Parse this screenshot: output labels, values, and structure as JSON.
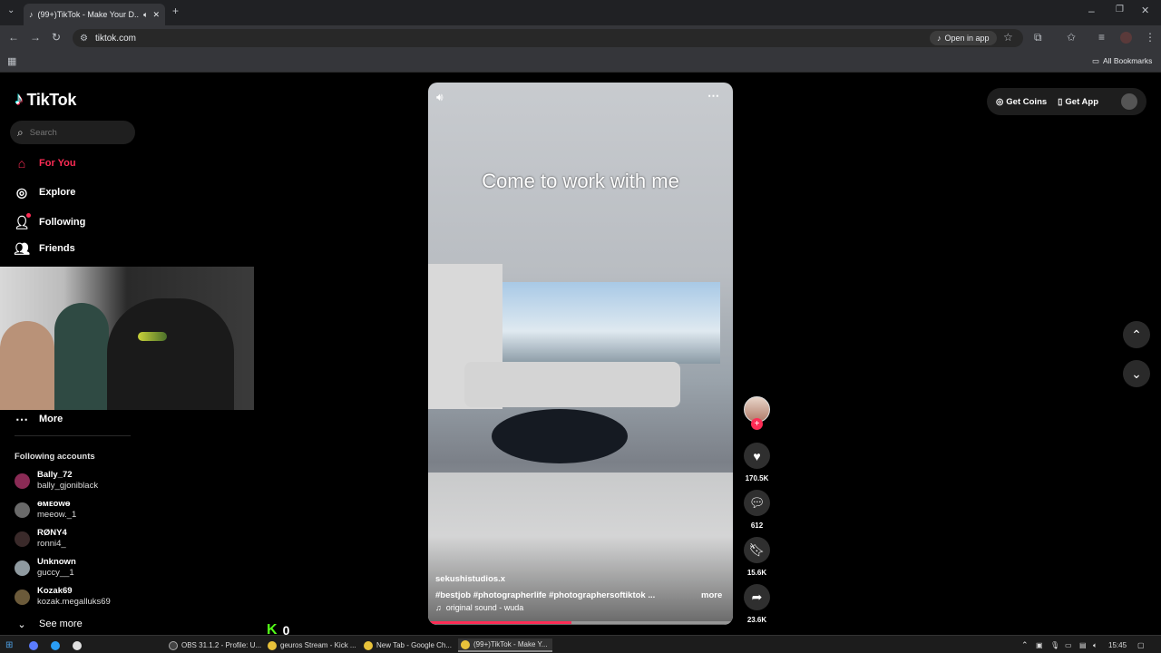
{
  "browser": {
    "tab_title": "(99+)TikTok - Make Your D...",
    "url": "tiktok.com",
    "open_in_app": "Open in app",
    "all_bookmarks": "All Bookmarks"
  },
  "brand": {
    "name": "TikTok"
  },
  "search": {
    "placeholder": "Search"
  },
  "nav": {
    "for_you": "For You",
    "explore": "Explore",
    "following": "Following",
    "friends": "Friends",
    "more": "More"
  },
  "following_accounts": {
    "heading": "Following accounts",
    "see_more": "See more",
    "items": [
      {
        "name": "Bally_72",
        "handle": "bally_gjoniblack"
      },
      {
        "name": "ɵᴍᴇᴏᴡɵ",
        "handle": "meeow._1"
      },
      {
        "name": "RØNY4",
        "handle": "ronni4_"
      },
      {
        "name": "Unknown",
        "handle": "guccy__1"
      },
      {
        "name": "Kozak69",
        "handle": "kozak.megalluks69"
      }
    ]
  },
  "header_actions": {
    "get_coins": "Get Coins",
    "get_app": "Get App"
  },
  "video": {
    "caption_overlay": "Come to work with me",
    "author": "sekushistudios.x",
    "hashtags": "#bestjob  #photographerlife  #photographersoftiktok  ...",
    "more": "more",
    "sound": "original sound - wuda",
    "progress": 0.47
  },
  "actions": {
    "likes": "170.5K",
    "comments": "612",
    "saves": "15.6K",
    "shares": "23.6K"
  },
  "stream_overlay": {
    "counter": "0"
  },
  "taskbar": {
    "obs": "OBS 31.1.2 - Profile: U...",
    "kick": "geuros Stream - Kick ...",
    "newtab": "New Tab - Google Ch...",
    "tiktok": "(99+)TikTok - Make Y...",
    "time": "15:45"
  },
  "colors": {
    "accent": "#fe2c55",
    "page_bg": "#000000",
    "sidebar_btn": "#2f2f2f"
  }
}
